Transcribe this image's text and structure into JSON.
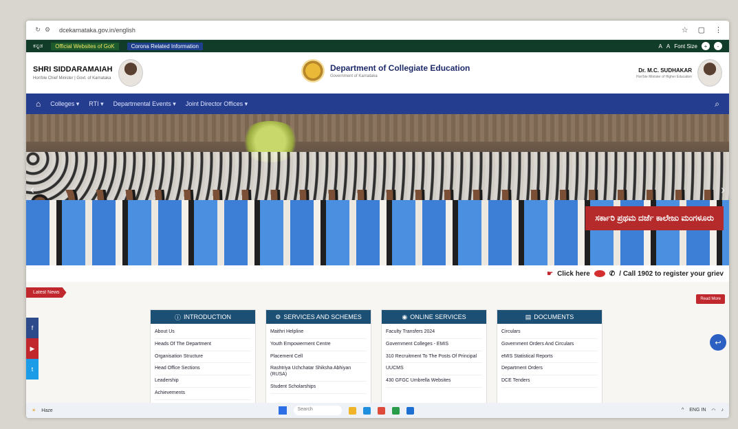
{
  "browser": {
    "url": "dcekarnataka.gov.in/english"
  },
  "utility": {
    "lang": "ಕನ್ನಡ",
    "official": "Official Websites of GoK",
    "corona": "Corona Related Information",
    "font_a_small": "A",
    "font_a_large": "A",
    "font_label": "Font Size"
  },
  "header": {
    "cm_name": "SHRI SIDDARAMAIAH",
    "cm_sub": "Hon'ble Chief Minister | Govt. of Karnataka",
    "dept_title": "Department of Collegiate Education",
    "dept_sub": "Government of Karnataka",
    "minister_name": "Dr. M.C. SUDHAKAR",
    "minister_sub": "Hon'ble Minister of Higher Education"
  },
  "nav": {
    "items": [
      "Colleges ▾",
      "RTI ▾",
      "Departmental Events ▾",
      "Joint Director Offices ▾"
    ]
  },
  "hero": {
    "banner": "ಸರ್ಕಾರಿ ಪ್ರಥಮ ದರ್ಜೆ ಕಾಲೇಜು ಮಂಗಳೂರು"
  },
  "notice": {
    "latest": "Latest News",
    "click": "Click here",
    "call": "/ Call 1902 to register your griev",
    "read_more": "Read More"
  },
  "panels": {
    "introduction": {
      "title": "INTRODUCTION",
      "items": [
        "About Us",
        "Heads Of The Department",
        "Organisation Structure",
        "Head Office Sections",
        "Leadership",
        "Achievements"
      ]
    },
    "services": {
      "title": "SERVICES AND SCHEMES",
      "items": [
        "Maithri Helpline",
        "Youth Empowerment Centre",
        "Placement Cell",
        "Rashtriya Uchchatar Shiksha Abhiyan (RUSA)",
        "Student Scholarships"
      ]
    },
    "online": {
      "title": "ONLINE SERVICES",
      "items": [
        "Faculty Transfers 2024",
        "Government Colleges - EMIS",
        "310 Recruitment To The Posts Of Principal",
        "UUCMS",
        "430 GFGC Umbrella Websites"
      ]
    },
    "documents": {
      "title": "DOCUMENTS",
      "items": [
        "Circulars",
        "Government Orders And Circulars",
        "eMIS Statistical Reports",
        "Department Orders",
        "DCE Tenders"
      ]
    }
  },
  "taskbar": {
    "weather": "Haze",
    "search": "Search",
    "lang": "ENG IN"
  },
  "colors": {
    "nav": "#253d8e",
    "panel_head": "#1b4f74",
    "accent_red": "#c0282d"
  }
}
